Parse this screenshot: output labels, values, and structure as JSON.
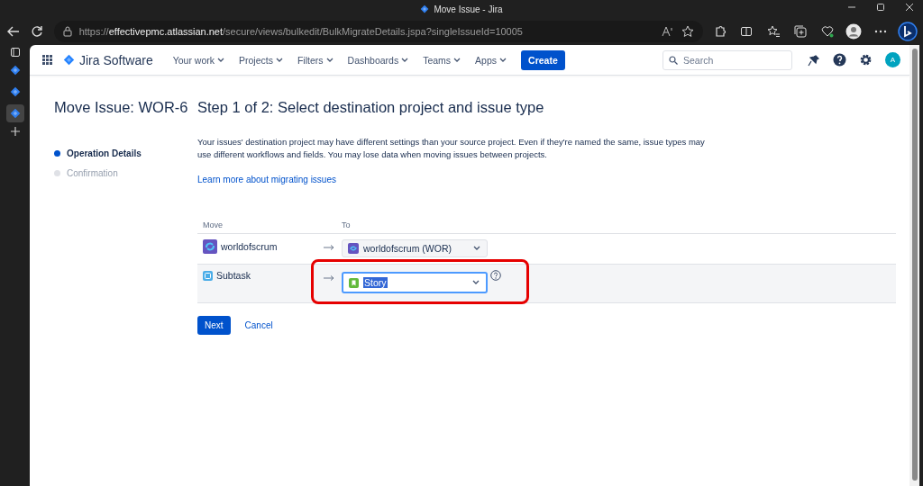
{
  "browser": {
    "tab_title": "Move Issue - Jira",
    "url_scheme": "https://",
    "url_host": "effectivepmc.atlassian.net",
    "url_path": "/secure/views/bulkedit/BulkMigrateDetails.jspa?singleIssueId=10005"
  },
  "vertical_tabs": [
    {
      "selected": false
    },
    {
      "selected": false
    },
    {
      "selected": true
    }
  ],
  "nav": {
    "product": "Jira Software",
    "menus": [
      "Your work",
      "Projects",
      "Filters",
      "Dashboards",
      "Teams",
      "Apps"
    ],
    "create": "Create",
    "search_placeholder": "Search",
    "avatar": "A"
  },
  "sidebar": {
    "title": "Move Issue: WOR-6",
    "steps": [
      {
        "label": "Operation Details",
        "selected": true
      },
      {
        "label": "Confirmation",
        "selected": false
      }
    ]
  },
  "main": {
    "heading": "Step 1 of 2: Select destination project and issue type",
    "description": "Your issues' destination project may have different settings than your source project. Even if they're named the same, issue types may use different workflows and fields. You may lose data when moving issues between projects.",
    "link": "Learn more about migrating issues",
    "columns": [
      "Move",
      "To"
    ],
    "rows": [
      {
        "kind": "project",
        "from": "worldofscrum",
        "to": "worldofscrum (WOR)",
        "focused": false,
        "annotated": false
      },
      {
        "kind": "issuetype",
        "from": "Subtask",
        "to": "Story",
        "focused": true,
        "annotated": true
      }
    ],
    "next": "Next",
    "cancel": "Cancel"
  }
}
